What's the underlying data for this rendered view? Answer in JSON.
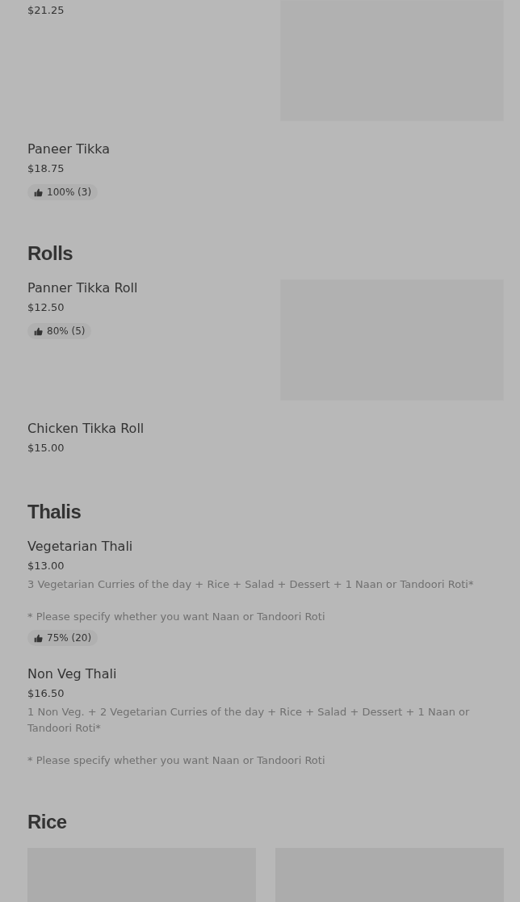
{
  "sections": [
    {
      "items": [
        {
          "price": "$21.25",
          "image": true
        },
        {
          "name": "Paneer Tikka",
          "price": "$18.75",
          "image": false,
          "rating": "100% (3)"
        }
      ]
    },
    {
      "title": "Rolls",
      "items": [
        {
          "name": "Panner Tikka Roll",
          "price": "$12.50",
          "image": true,
          "rating": "80% (5)"
        },
        {
          "name": "Chicken Tikka Roll",
          "price": "$15.00",
          "image": false
        }
      ]
    },
    {
      "title": "Thalis",
      "items": [
        {
          "name": "Vegetarian Thali",
          "price": "$13.00",
          "image": false,
          "description": "3 Vegetarian Curries of the day + Rice + Salad + Dessert + 1 Naan or Tandoori Roti*",
          "note": "* Please specify whether you want Naan or Tandoori Roti",
          "rating": "75% (20)"
        },
        {
          "name": "Non Veg Thali",
          "price": "$16.50",
          "image": false,
          "description": "1 Non Veg. + 2 Vegetarian Curries of the day + Rice + Salad + Dessert + 1 Naan or Tandoori Roti*",
          "note": "* Please specify whether you want Naan or Tandoori Roti"
        }
      ]
    },
    {
      "title": "Rice",
      "items": [
        {
          "image": true
        },
        {
          "image": true
        }
      ]
    }
  ]
}
